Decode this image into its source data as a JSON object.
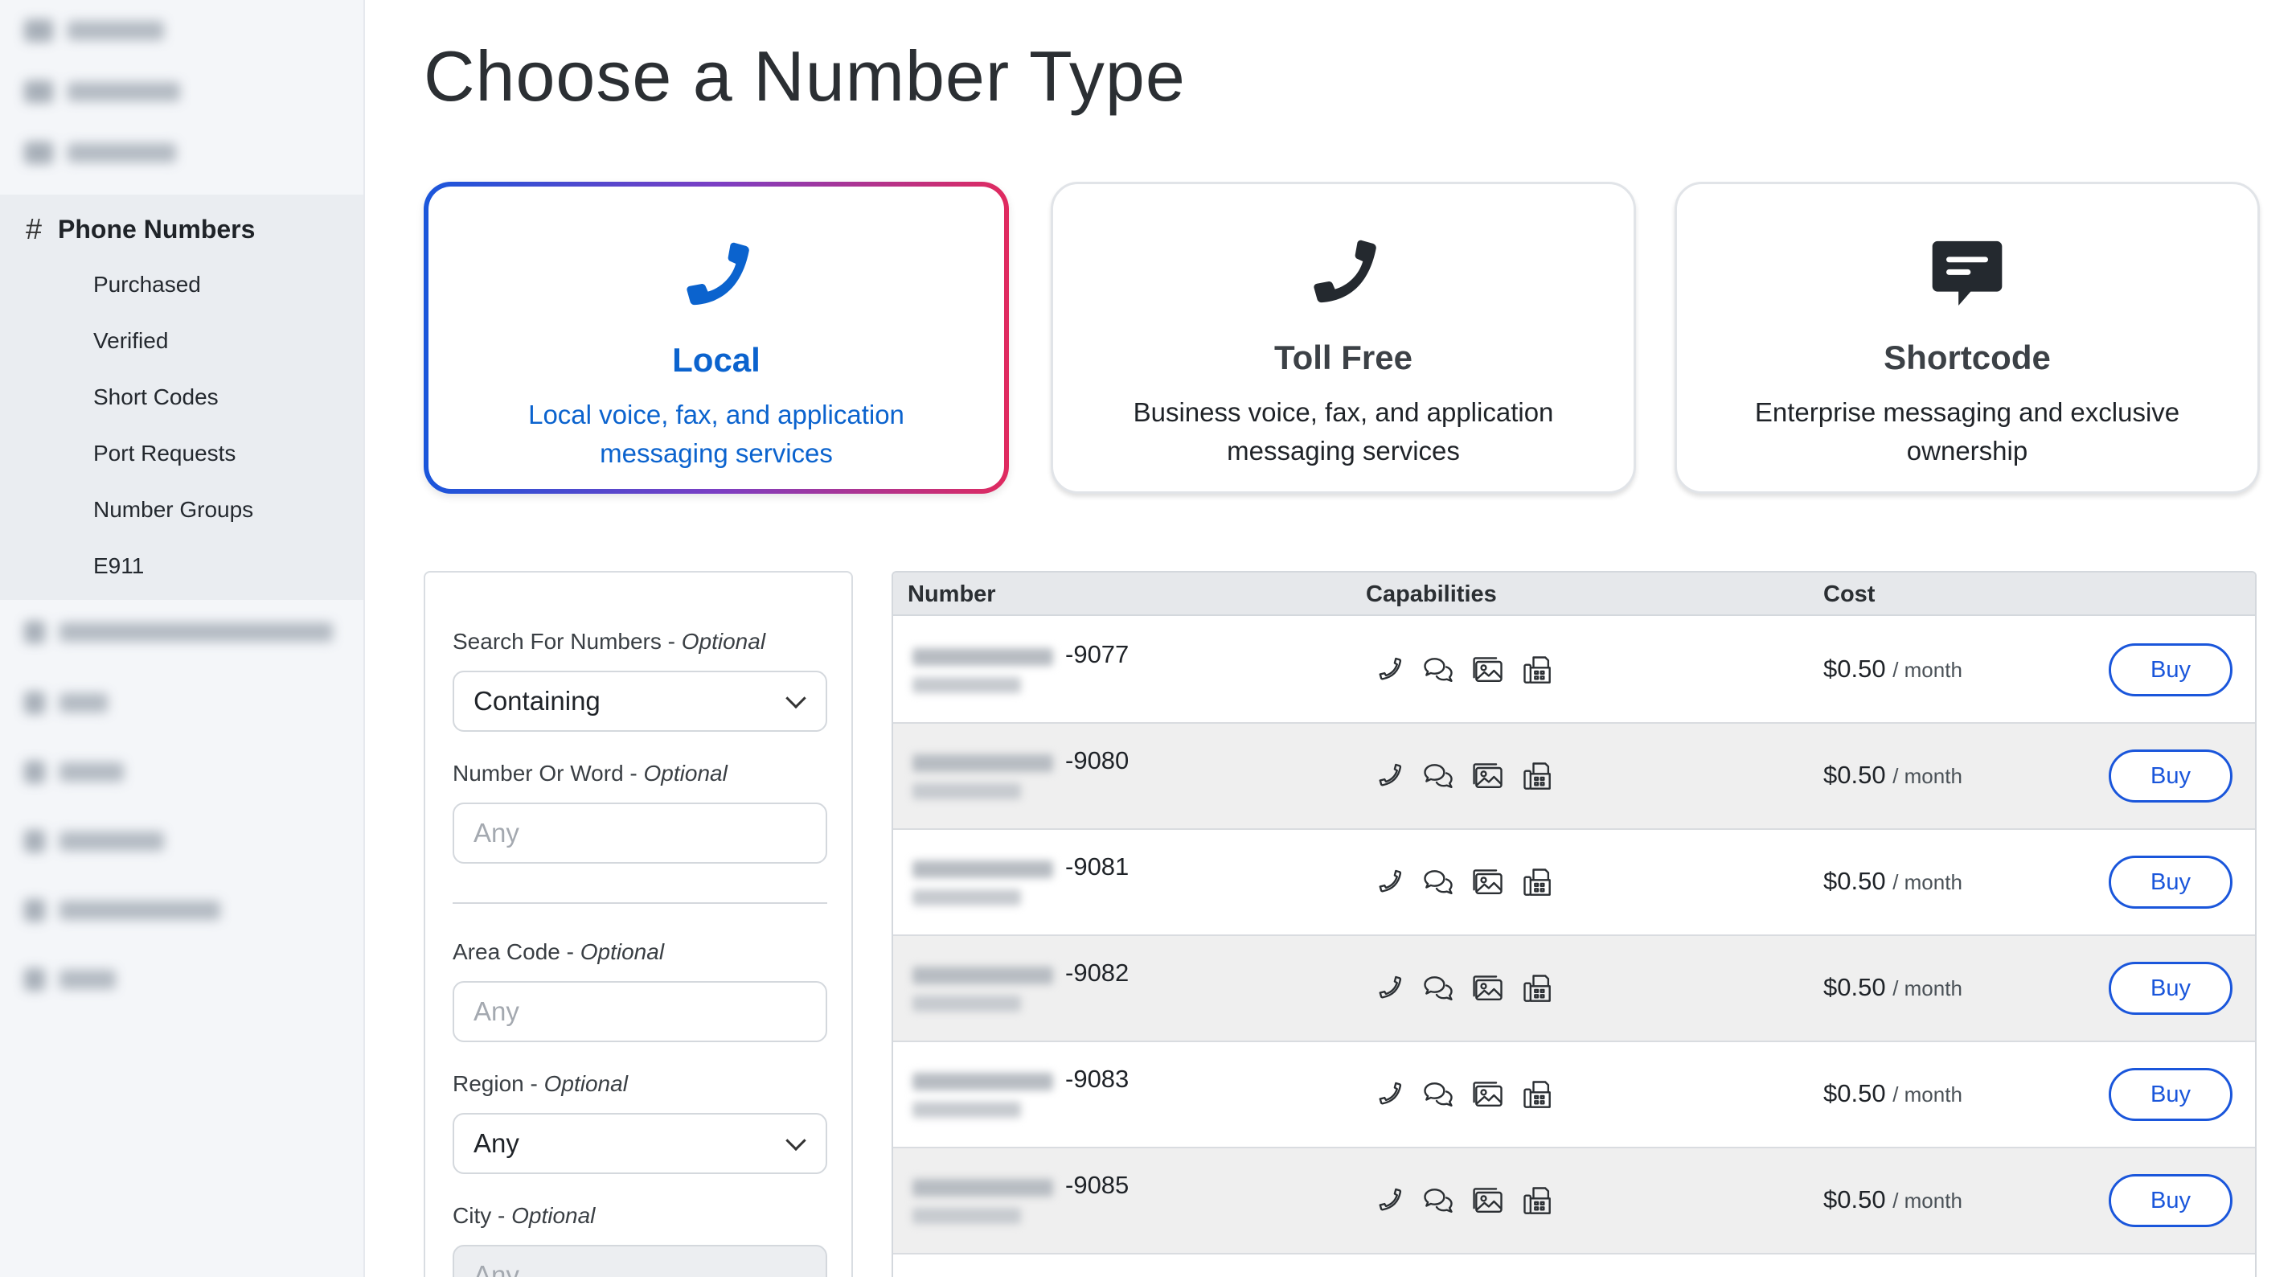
{
  "sidebar": {
    "section": {
      "hash": "#",
      "title": "Phone Numbers",
      "items": [
        {
          "label": "Purchased"
        },
        {
          "label": "Verified"
        },
        {
          "label": "Short Codes"
        },
        {
          "label": "Port Requests"
        },
        {
          "label": "Number Groups"
        },
        {
          "label": "E911"
        }
      ]
    }
  },
  "page": {
    "title": "Choose a Number Type"
  },
  "number_types": [
    {
      "title": "Local",
      "desc": "Local voice, fax, and application messaging services",
      "icon": "phone-icon",
      "selected": true
    },
    {
      "title": "Toll Free",
      "desc": "Business voice, fax, and application messaging services",
      "icon": "phone-icon",
      "selected": false
    },
    {
      "title": "Shortcode",
      "desc": "Enterprise messaging and exclusive ownership",
      "icon": "message-icon",
      "selected": false
    }
  ],
  "filters": {
    "search_for": {
      "label": "Search For Numbers - ",
      "optional": "Optional",
      "value": "Containing"
    },
    "number_or_word": {
      "label": "Number Or Word - ",
      "optional": "Optional",
      "placeholder": "Any"
    },
    "area_code": {
      "label": "Area Code - ",
      "optional": "Optional",
      "placeholder": "Any"
    },
    "region": {
      "label": "Region - ",
      "optional": "Optional",
      "value": "Any"
    },
    "city": {
      "label": "City - ",
      "optional": "Optional",
      "placeholder": "Any"
    }
  },
  "table": {
    "headers": {
      "number": "Number",
      "capabilities": "Capabilities",
      "cost": "Cost"
    },
    "capability_icons": [
      "voice-icon",
      "sms-icon",
      "mms-icon",
      "fax-icon"
    ],
    "rows": [
      {
        "suffix": "-9077",
        "price": "$0.50",
        "per": "/ month",
        "action": "Buy"
      },
      {
        "suffix": "-9080",
        "price": "$0.50",
        "per": "/ month",
        "action": "Buy"
      },
      {
        "suffix": "-9081",
        "price": "$0.50",
        "per": "/ month",
        "action": "Buy"
      },
      {
        "suffix": "-9082",
        "price": "$0.50",
        "per": "/ month",
        "action": "Buy"
      },
      {
        "suffix": "-9083",
        "price": "$0.50",
        "per": "/ month",
        "action": "Buy"
      },
      {
        "suffix": "-9085",
        "price": "$0.50",
        "per": "/ month",
        "action": "Buy"
      }
    ]
  },
  "colors": {
    "accent": "#1a56db",
    "selected_text": "#0b63ce",
    "gradient_end": "#e02a5f"
  }
}
